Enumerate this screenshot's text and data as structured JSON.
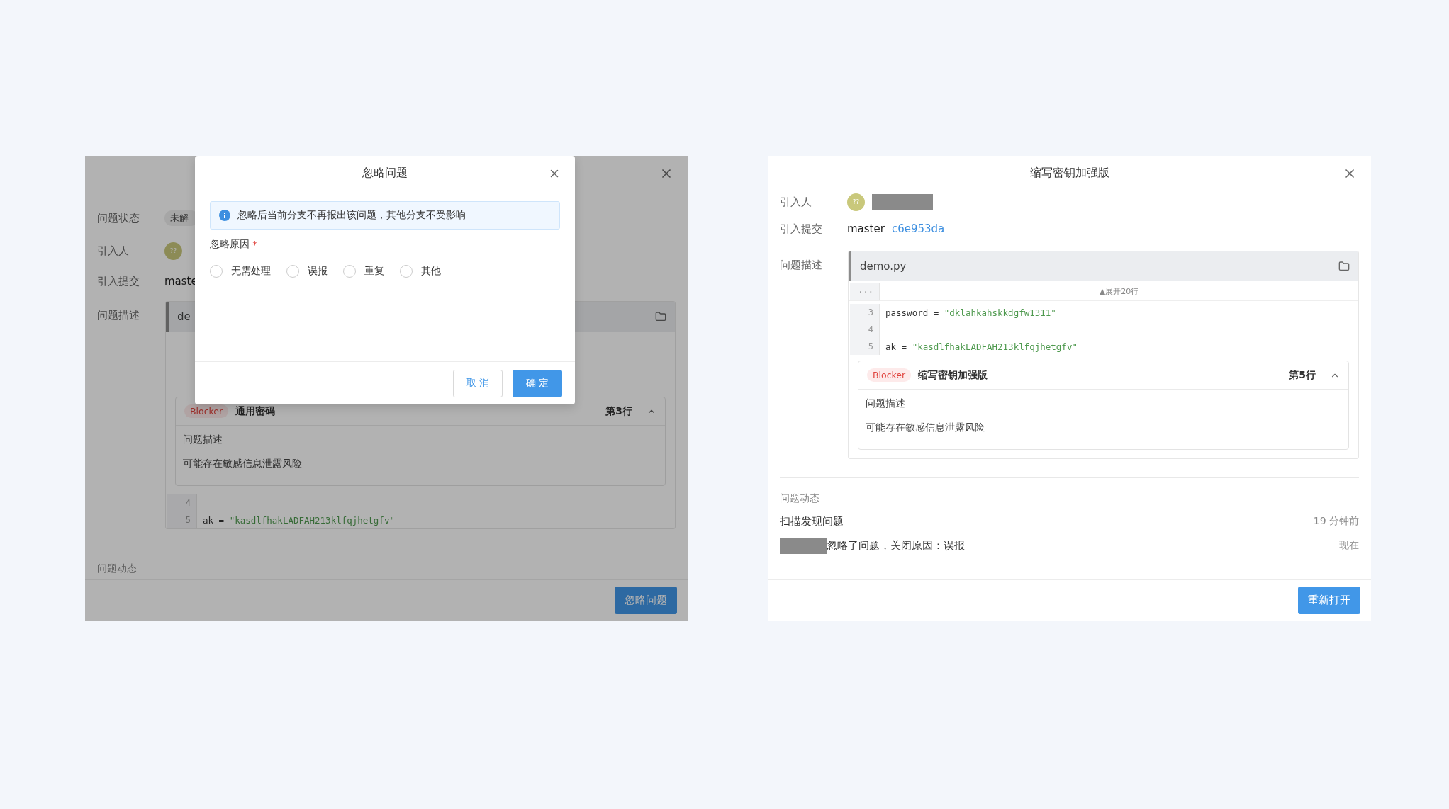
{
  "left_drawer": {
    "fields": [
      {
        "label": "问题状态",
        "kind": "tag",
        "text": "未解"
      },
      {
        "label": "引入人",
        "kind": "avatar",
        "text": "??"
      },
      {
        "label": "引入提交",
        "kind": "text",
        "text": "maste"
      }
    ],
    "description_label": "问题描述",
    "file": {
      "name": "de"
    },
    "code_items": [
      {
        "kind": "hidden"
      },
      {
        "kind": "issue",
        "severity": "Blocker",
        "title": "通用密码",
        "line": "第3行",
        "expanded": true,
        "heading": "问题描述",
        "text": "可能存在敏感信息泄露风险"
      },
      {
        "kind": "line",
        "number": "4"
      },
      {
        "kind": "line",
        "number": "5",
        "code": "ak = ",
        "string": "\"kasdlfhakLADFAH213klfqjhetgfv\""
      }
    ],
    "activity_label": "问题动态",
    "footer_button": "忽略问题"
  },
  "ignore_dialog": {
    "title": "忽略问题",
    "notice": "忽略后当前分支不再报出该问题，其他分支不受影响",
    "reason_label": "忽略原因",
    "required_mark": "*",
    "options": [
      {
        "label": "无需处理",
        "selected": false
      },
      {
        "label": "误报",
        "selected": false
      },
      {
        "label": "重复",
        "selected": false
      },
      {
        "label": "其他",
        "selected": false
      }
    ],
    "buttons": [
      {
        "label": "取 消",
        "kind": "default"
      },
      {
        "label": "确 定",
        "kind": "primary"
      }
    ]
  },
  "right_drawer": {
    "title": "缩写密钥加强版",
    "fields": [
      {
        "label": "引入人",
        "values": [
          {
            "kind": "avatar",
            "text": "??"
          },
          {
            "kind": "redacted"
          }
        ]
      },
      {
        "label": "引入提交",
        "values": [
          {
            "kind": "text",
            "text": "master"
          },
          {
            "kind": "link",
            "text": "c6e953da"
          }
        ]
      }
    ],
    "description_label": "问题描述",
    "file": {
      "name": "demo.py"
    },
    "code_items": [
      {
        "kind": "expand",
        "gutter": "···",
        "text": "▲展开20行"
      },
      {
        "kind": "line",
        "number": "3",
        "code": "password = ",
        "string": "\"dklahkahskkdgfw1311\""
      },
      {
        "kind": "line",
        "number": "4"
      },
      {
        "kind": "line",
        "number": "5",
        "code": "ak = ",
        "string": "\"kasdlfhakLADFAH213klfqjhetgfv\""
      },
      {
        "kind": "issue",
        "severity": "Blocker",
        "title": "缩写密钥加强版",
        "line": "第5行",
        "expanded": true,
        "heading": "问题描述",
        "text": "可能存在敏感信息泄露风险"
      }
    ],
    "activity_label": "问题动态",
    "activity": [
      {
        "redacted_actor": false,
        "text": "扫描发现问题",
        "time": "19 分钟前"
      },
      {
        "redacted_actor": true,
        "text": "忽略了问题，关闭原因：误报",
        "time": "现在"
      }
    ],
    "footer_button": "重新打开"
  }
}
